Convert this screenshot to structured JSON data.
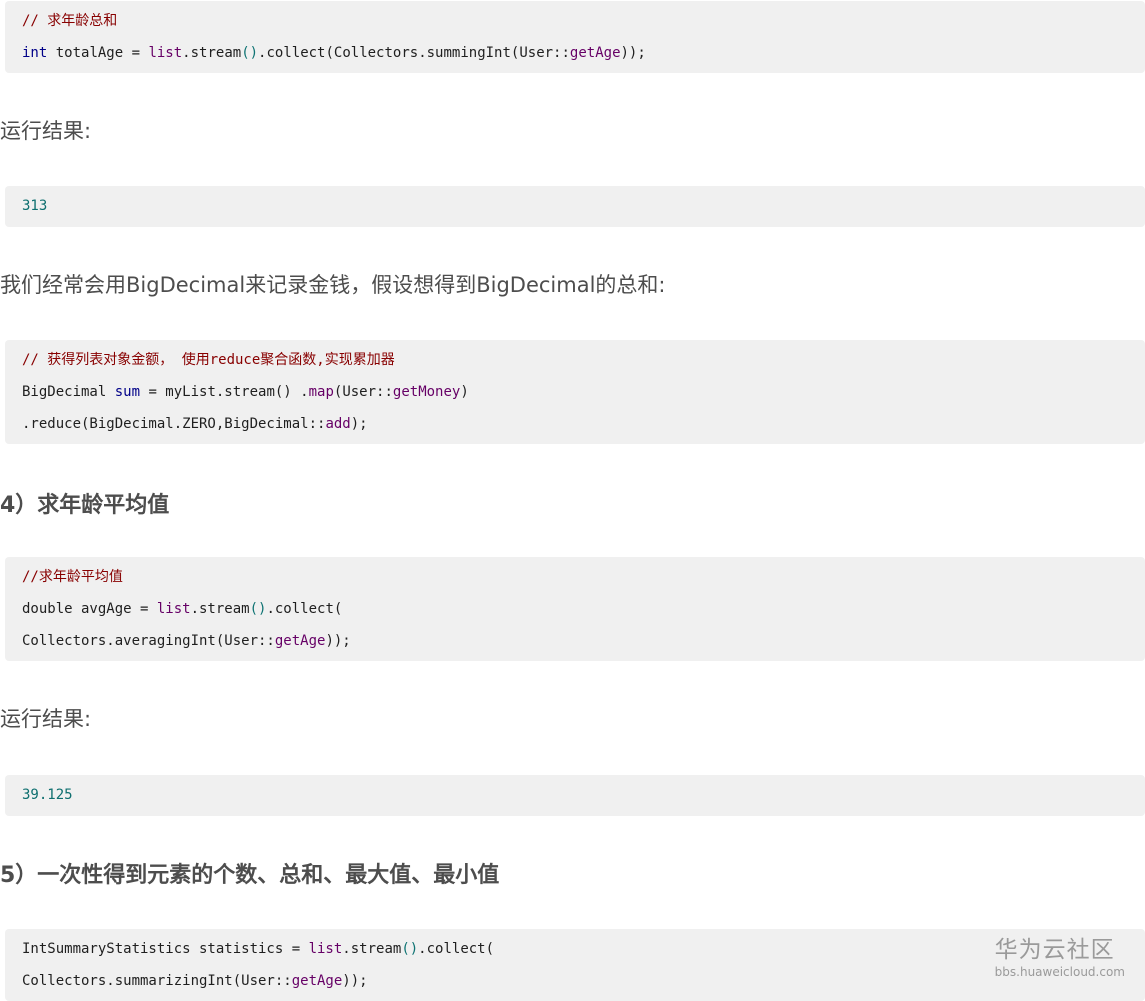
{
  "blocks": [
    {
      "kind": "code",
      "lines": [
        [
          {
            "t": "// 求年龄总和",
            "c": "comment"
          }
        ],
        [
          {
            "t": "int",
            "c": "keyword"
          },
          {
            "t": " totalAge = ",
            "c": "plain"
          },
          {
            "t": "list",
            "c": "ident"
          },
          {
            "t": ".stream",
            "c": "plain"
          },
          {
            "t": "()",
            "c": "paren"
          },
          {
            "t": ".collect(Collectors.summingInt(User::",
            "c": "plain"
          },
          {
            "t": "getAge",
            "c": "ident"
          },
          {
            "t": "));",
            "c": "plain"
          }
        ]
      ]
    },
    {
      "kind": "para",
      "text": "运行结果:"
    },
    {
      "kind": "code",
      "lines": [
        [
          {
            "t": "313",
            "c": "number"
          }
        ]
      ]
    },
    {
      "kind": "para",
      "text": "我们经常会用BigDecimal来记录金钱，假设想得到BigDecimal的总和:"
    },
    {
      "kind": "code",
      "lines": [
        [
          {
            "t": "// 获得列表对象金额， 使用reduce聚合函数,实现累加器",
            "c": "comment"
          }
        ],
        [
          {
            "t": "BigDecimal ",
            "c": "plain"
          },
          {
            "t": "sum",
            "c": "keyword"
          },
          {
            "t": " = myList.stream() .",
            "c": "plain"
          },
          {
            "t": "map",
            "c": "ident"
          },
          {
            "t": "(User::",
            "c": "plain"
          },
          {
            "t": "getMoney",
            "c": "ident"
          },
          {
            "t": ")",
            "c": "plain"
          }
        ],
        [
          {
            "t": ".reduce(BigDecimal.ZERO,BigDecimal::",
            "c": "plain"
          },
          {
            "t": "add",
            "c": "ident"
          },
          {
            "t": ");",
            "c": "plain"
          }
        ]
      ]
    },
    {
      "kind": "heading",
      "text": "4）求年龄平均值"
    },
    {
      "kind": "code",
      "lines": [
        [
          {
            "t": "//求年龄平均值",
            "c": "comment"
          }
        ],
        [
          {
            "t": "double avgAge = ",
            "c": "plain"
          },
          {
            "t": "list",
            "c": "ident"
          },
          {
            "t": ".stream",
            "c": "plain"
          },
          {
            "t": "()",
            "c": "paren"
          },
          {
            "t": ".collect(",
            "c": "plain"
          }
        ],
        [
          {
            "t": "Collectors.averagingInt(User::",
            "c": "plain"
          },
          {
            "t": "getAge",
            "c": "ident"
          },
          {
            "t": "));",
            "c": "plain"
          }
        ]
      ]
    },
    {
      "kind": "para",
      "text": "运行结果:"
    },
    {
      "kind": "code",
      "lines": [
        [
          {
            "t": "39.125",
            "c": "number"
          }
        ]
      ]
    },
    {
      "kind": "heading",
      "text": "5）一次性得到元素的个数、总和、最大值、最小值"
    },
    {
      "kind": "code",
      "lines": [
        [
          {
            "t": "IntSummaryStatistics statistics = ",
            "c": "plain"
          },
          {
            "t": "list",
            "c": "ident"
          },
          {
            "t": ".stream",
            "c": "plain"
          },
          {
            "t": "()",
            "c": "paren"
          },
          {
            "t": ".collect(",
            "c": "plain"
          }
        ],
        [
          {
            "t": "Collectors.summarizingInt(User::",
            "c": "plain"
          },
          {
            "t": "getAge",
            "c": "ident"
          },
          {
            "t": "));",
            "c": "plain"
          }
        ]
      ]
    }
  ],
  "watermark": {
    "title": "华为云社区",
    "url": "bbs.huaweicloud.com"
  }
}
